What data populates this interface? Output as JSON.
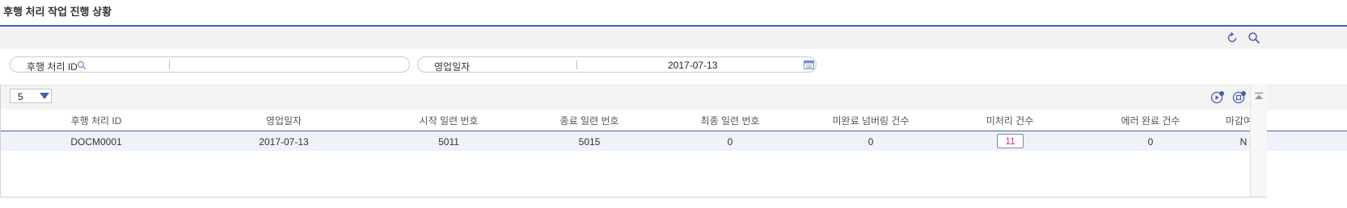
{
  "page": {
    "title": "후행 처리 작업 진행 상황"
  },
  "toolbar": {
    "refresh_icon": "refresh-icon",
    "search_icon": "search-icon"
  },
  "search": {
    "id_label": "후행 처리 ID",
    "id_value": "",
    "date_label": "영업일자",
    "date_value": "2017-07-13"
  },
  "grid": {
    "page_size": "5",
    "columns": [
      "후행 처리 ID",
      "영업일자",
      "시작 일련 번호",
      "종료 일련 번호",
      "최종 일련 번호",
      "미완료 넘버링 건수",
      "미처리 건수",
      "에러 완료 건수",
      "마감여부"
    ],
    "rows": [
      {
        "id": "DOCM0001",
        "date": "2017-07-13",
        "start": "5011",
        "end": "5015",
        "last": "0",
        "incomplete": "0",
        "unprocessed": "11",
        "error": "0",
        "closed": "N"
      }
    ]
  },
  "colors": {
    "accent": "#4a5ea8",
    "highlight_text": "#d6367a",
    "row_bg": "#eef2f9"
  }
}
